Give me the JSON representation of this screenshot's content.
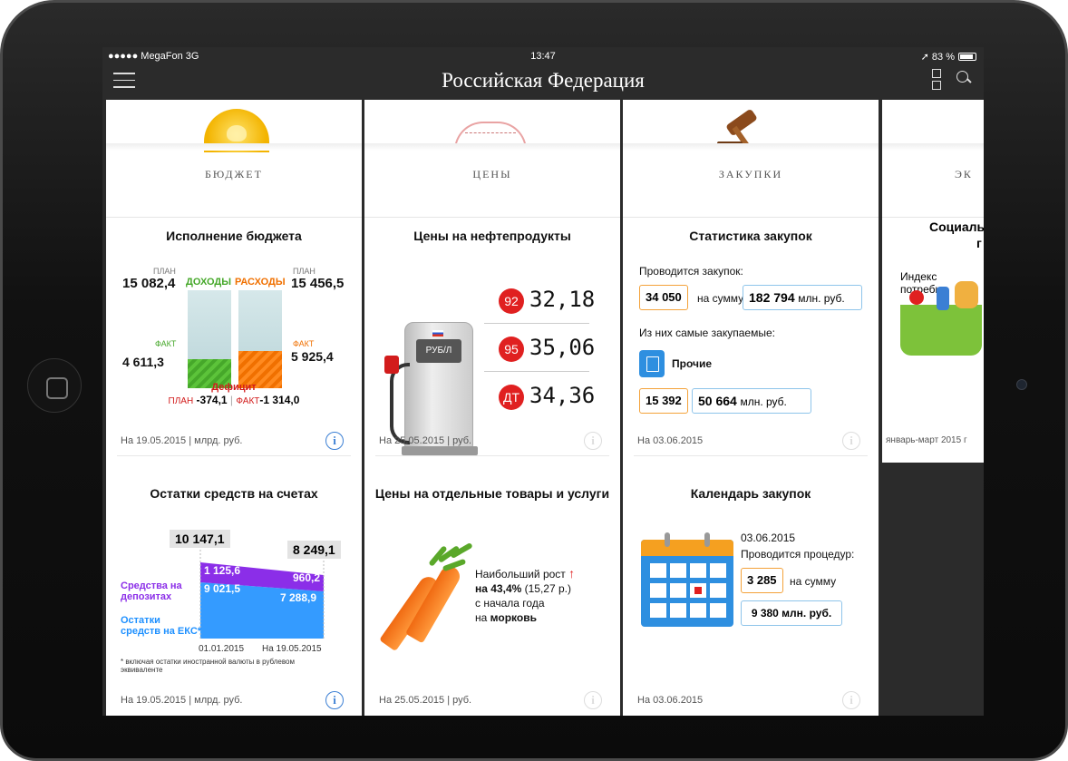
{
  "status": {
    "carrier": "●●●●● MegaFon  3G",
    "time": "13:47",
    "battery": "➚ 83 %"
  },
  "nav": {
    "title": "Российская Федерация"
  },
  "columns": {
    "budget": {
      "header": "БЮДЖЕТ"
    },
    "prices": {
      "header": "ЦЕНЫ"
    },
    "procurement": {
      "header": "ЗАКУПКИ"
    },
    "economy": {
      "header": "ЭК"
    }
  },
  "budget": {
    "title": "Исполнение бюджета",
    "plan_label": "ПЛАН",
    "plan_left": "15 082,4",
    "plan_right": "15 456,5",
    "income_label": "ДОХОДЫ",
    "expense_label": "РАСХОДЫ",
    "fact_label": "ФАКТ",
    "fact_left": "4 611,3",
    "fact_right": "5 925,4",
    "income_fact_ratio": 0.3,
    "expense_fact_ratio": 0.38,
    "deficit_label": "Дефицит",
    "deficit_plan_label": "ПЛАН",
    "deficit_plan": "-374,1",
    "deficit_fact_label": "ФАКТ",
    "deficit_fact": "-1 314,0",
    "footer": "На 19.05.2015 | млрд. руб."
  },
  "fuel": {
    "title": "Цены на нефтепродукты",
    "pump_label": "РУБ/Л",
    "items": [
      {
        "badge": "92",
        "price": "32,18"
      },
      {
        "badge": "95",
        "price": "35,06"
      },
      {
        "badge": "ДТ",
        "price": "34,36"
      }
    ],
    "footer": "На 25.05.2015 | руб."
  },
  "procurement_stats": {
    "title": "Статистика закупок",
    "line1": "Проводится закупок:",
    "count": "34 050",
    "sum_label": "на сумму",
    "sum": "182 794",
    "sum_unit": "млн. руб.",
    "line2": "Из них самые закупаемые:",
    "category": "Прочие",
    "cat_count": "15 392",
    "cat_sum": "50 664",
    "cat_unit": "млн. руб.",
    "footer": "На 03.06.2015"
  },
  "economy": {
    "title_a": "Социаль",
    "title_b": "г",
    "index_label": "Индекс потребит",
    "footer": "январь-март 2015 г"
  },
  "savings": {
    "title": "Остатки средств на счетах",
    "left_total": "10 147,1",
    "right_total": "8 249,1",
    "deposits_left": "1 125,6",
    "deposits_right": "960,2",
    "eks_left": "9 021,5",
    "eks_right": "7 288,9",
    "deposits_label": "Средства на депозитах",
    "eks_label": "Остатки средств на ЕКС*",
    "date_left": "01.01.2015",
    "date_right": "На 19.05.2015",
    "note": "* включая остатки иностранной валюты в рублевом эквиваленте",
    "footer": "На 19.05.2015 | млрд. руб.",
    "purple": "#8b2ee8",
    "blue": "#1e90ff"
  },
  "goods": {
    "title": "Цены на отдельные товары и услуги",
    "line1": "Наибольший рост",
    "line2_bold": "на 43,4%",
    "line2_rest": "(15,27 р.)",
    "line3": "с начала года",
    "line4_prefix": "на",
    "line4_bold": "морковь",
    "footer": "На 25.05.2015 | руб."
  },
  "calendar": {
    "title": "Календарь закупок",
    "date": "03.06.2015",
    "line1": "Проводится процедур:",
    "count": "3 285",
    "sum_label": "на сумму",
    "sum": "9 380 млн. руб.",
    "footer": "На 03.06.2015"
  },
  "icons": {
    "info": "i"
  }
}
